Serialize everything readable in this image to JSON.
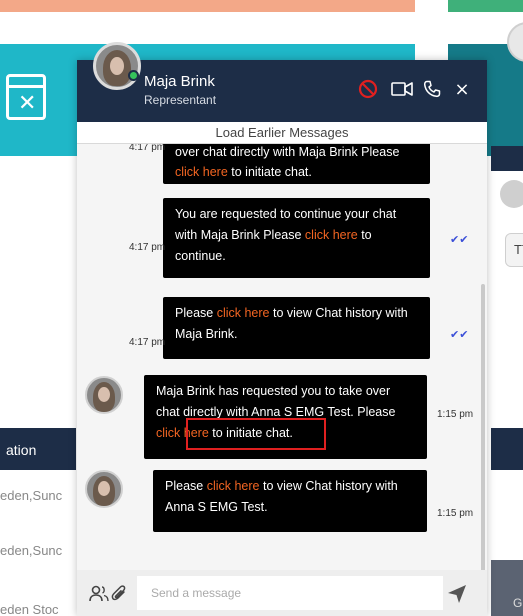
{
  "background": {
    "table_header": "ation",
    "rows": [
      "eden,Sunc",
      "eden,Sunc",
      "eden Stoc"
    ],
    "right_badge": "TT",
    "right_button": "G"
  },
  "chat": {
    "contact_name": "Maja Brink",
    "contact_role": "Representant",
    "load_earlier": "Load Earlier Messages",
    "icons": [
      "block-icon",
      "video-icon",
      "phone-icon",
      "close-icon"
    ],
    "close_glyph": "×",
    "messages": [
      {
        "pre": "",
        "link": "click here",
        "post": " to initiate chat.",
        "partial_top": "over chat directly with Maja Brink Please",
        "time": "4:17 pm"
      },
      {
        "pre": "You are requested to continue your chat with Maja Brink Please ",
        "link": "click here",
        "post": " to continue.",
        "time": "4:17 pm"
      },
      {
        "pre": "Please ",
        "link": "click here",
        "post": " to view Chat history with Maja Brink.",
        "time": "4:17 pm"
      },
      {
        "pre": "Maja Brink has requested you to take over chat directly with Anna S EMG Test. Please ",
        "link": "click here",
        "post": " to initiate chat.",
        "time": "1:15 pm"
      },
      {
        "pre": "Please ",
        "link": "click here",
        "post": " to view Chat history with Anna S EMG Test.",
        "time": "1:15 pm"
      }
    ],
    "read_tick": "✔✔",
    "composer": {
      "placeholder": "Send a message"
    }
  },
  "colors": {
    "header_bg": "#1d2d47",
    "bubble_bg": "#000000",
    "link": "#f26522",
    "online": "#35c15b",
    "block_red": "#e02020",
    "tick_blue": "#3b4fd8"
  }
}
